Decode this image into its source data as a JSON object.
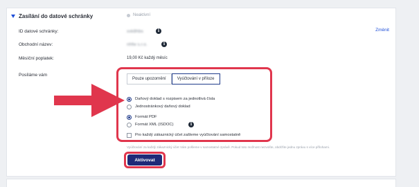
{
  "section": {
    "title": "Zasílání do datové schránky",
    "status": "Neaktivní",
    "change_link": "Změnit"
  },
  "fields": {
    "box_id_label": "ID datové schránky:",
    "box_id_value": "xxk8hbs",
    "business_name_label": "Obchodní název:",
    "business_name_value": "nhfw s.r.o.",
    "monthly_fee_label": "Měsíční poplatek:",
    "monthly_fee_value": "19,00 Kč každý měsíc",
    "we_send_label": "Posíláme vám"
  },
  "tabs": [
    {
      "label": "Pouze upozornění",
      "active": false
    },
    {
      "label": "Vyúčtování v příloze",
      "active": true
    }
  ],
  "document_options": [
    {
      "label": "Daňový doklad s rozpisem za jednotlivá čísla",
      "selected": true
    },
    {
      "label": "Jednostránkový daňový doklad",
      "selected": false
    }
  ],
  "format_options": [
    {
      "label": "Formát PDF",
      "selected": true
    },
    {
      "label": "Formát XML (ISDOC)",
      "selected": false
    }
  ],
  "separate_billing_checkbox": {
    "label": "Pro každý zákaznický účet zašleme vyúčtování samostatně",
    "checked": false
  },
  "help_text": "Vyúčtování za každý zákaznický účet Vám pošleme v samostatné zprávě. Pokud toto možnost nezvolíte, obdržíte jednu zprávu s více přílohami.",
  "activate_button": "Aktivovat",
  "colors": {
    "accent": "#1e2a78",
    "highlight": "#e0364d",
    "link": "#1d4ed8"
  }
}
